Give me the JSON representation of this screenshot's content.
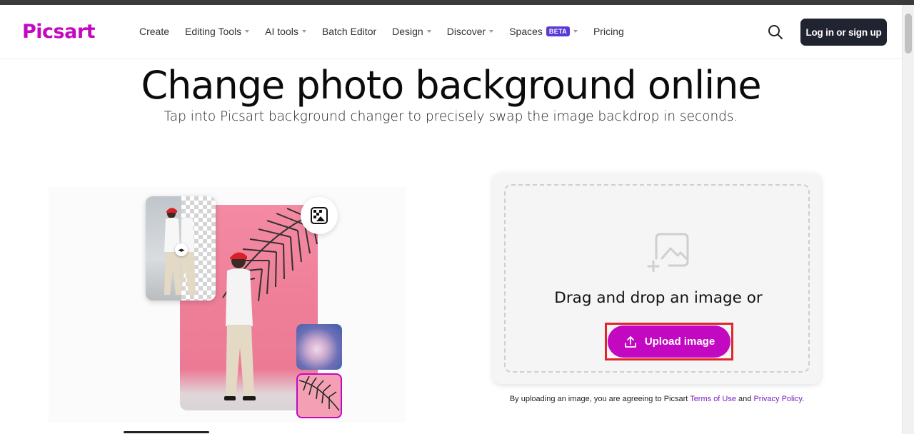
{
  "header": {
    "logo": "Picsart",
    "nav": [
      {
        "label": "Create",
        "caret": false
      },
      {
        "label": "Editing Tools",
        "caret": true
      },
      {
        "label": "AI tools",
        "caret": true
      },
      {
        "label": "Batch Editor",
        "caret": false
      },
      {
        "label": "Design",
        "caret": true
      },
      {
        "label": "Discover",
        "caret": true
      },
      {
        "label": "Spaces",
        "caret": true,
        "badge": "BETA"
      },
      {
        "label": "Pricing",
        "caret": false
      }
    ],
    "login_label": "Log in or sign up"
  },
  "hero": {
    "title": "Change photo background online",
    "subtitle": "Tap into Picsart background changer to precisely swap the image backdrop in seconds."
  },
  "upload": {
    "drop_text": "Drag and drop an image or",
    "button_label": "Upload image",
    "legal_prefix": "By uploading an image, you are agreeing to Picsart ",
    "terms_link": "Terms of Use",
    "legal_and": " and ",
    "privacy_link": "Privacy Policy",
    "legal_suffix": "."
  },
  "colors": {
    "brand": "#c209c1",
    "dark_button": "#1f2430",
    "beta_badge": "#5a3ad6",
    "highlight_outline": "#e0262a"
  },
  "icons": {
    "search": "search-icon",
    "upload": "upload-icon",
    "add_image": "add-image-icon",
    "background_tool": "background-tool-icon",
    "compare_handle": "compare-handle-icon"
  }
}
